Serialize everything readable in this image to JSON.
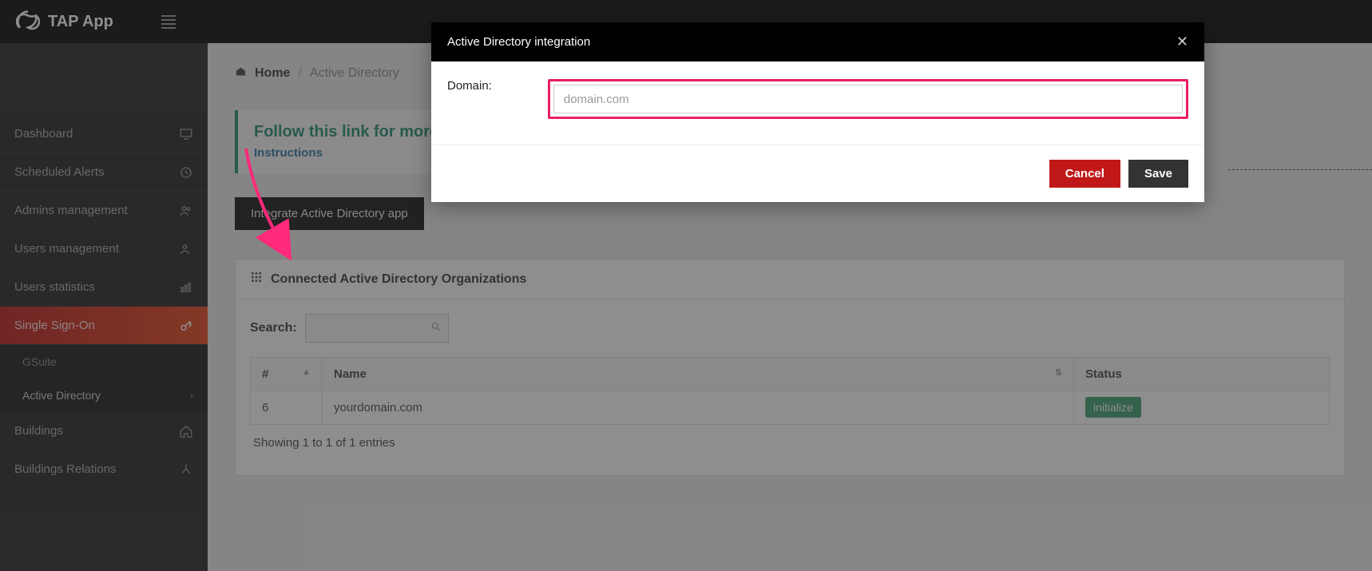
{
  "topbar": {
    "app_name": "TAP App"
  },
  "sidebar": {
    "items": [
      {
        "label": "Dashboard"
      },
      {
        "label": "Scheduled Alerts"
      },
      {
        "label": "Admins management"
      },
      {
        "label": "Users management"
      },
      {
        "label": "Users statistics"
      },
      {
        "label": "Single Sign-On"
      },
      {
        "label": "Buildings"
      },
      {
        "label": "Buildings Relations"
      }
    ],
    "subitems": [
      {
        "label": "GSuite"
      },
      {
        "label": "Active Directory"
      }
    ]
  },
  "breadcrumb": {
    "home": "Home",
    "current": "Active Directory"
  },
  "info": {
    "title": "Follow this link for more info",
    "link_label": "Instructions"
  },
  "integrate_button": "Integrate Active Directory app",
  "panel": {
    "title": "Connected Active Directory Organizations",
    "search_label": "Search:",
    "columns": {
      "idx": "#",
      "name": "Name",
      "status": "Status"
    },
    "rows": [
      {
        "idx": "6",
        "name": "yourdomain.com",
        "status_action": "initialize"
      }
    ],
    "footer": "Showing 1 to 1 of 1 entries"
  },
  "modal": {
    "title": "Active Directory integration",
    "domain_label": "Domain:",
    "domain_placeholder": "domain.com",
    "cancel": "Cancel",
    "save": "Save"
  }
}
